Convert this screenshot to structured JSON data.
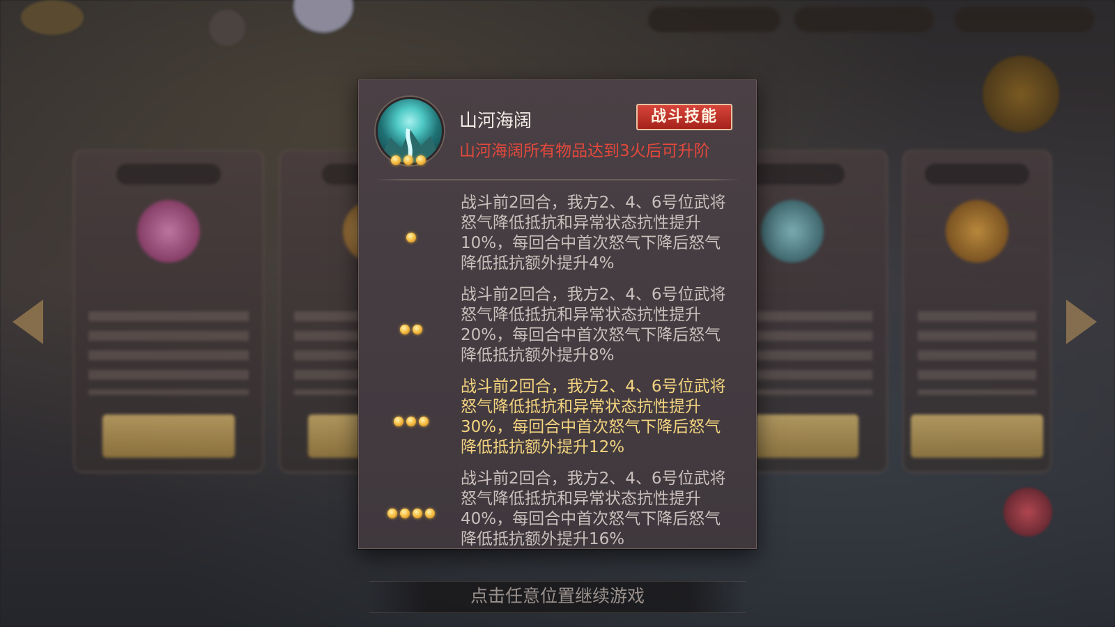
{
  "skill": {
    "name": "山河海阔",
    "badge": "战斗技能",
    "upgrade_note": "山河海阔所有物品达到3火后可升阶",
    "icon": "mountain-waterfall-icon",
    "icon_stars": 3
  },
  "levels": [
    {
      "fires": 1,
      "active": false,
      "description": "战斗前2回合，我方2、4、6号位武将怒气降低抵抗和异常状态抗性提升10%，每回合中首次怒气下降后怒气降低抵抗额外提升4%"
    },
    {
      "fires": 2,
      "active": false,
      "description": "战斗前2回合，我方2、4、6号位武将怒气降低抵抗和异常状态抗性提升20%，每回合中首次怒气下降后怒气降低抵抗额外提升8%"
    },
    {
      "fires": 3,
      "active": true,
      "description": "战斗前2回合，我方2、4、6号位武将怒气降低抵抗和异常状态抗性提升30%，每回合中首次怒气下降后怒气降低抵抗额外提升12%"
    },
    {
      "fires": 4,
      "active": false,
      "description": "战斗前2回合，我方2、4、6号位武将怒气降低抵抗和异常状态抗性提升40%，每回合中首次怒气下降后怒气降低抵抗额外提升16%"
    }
  ],
  "footer": {
    "hint": "点击任意位置继续游戏"
  },
  "colors": {
    "badge_red": "#c7352b",
    "note_red": "#e4483c",
    "active_text": "#f3d37f",
    "normal_text": "#c9bfbc"
  }
}
